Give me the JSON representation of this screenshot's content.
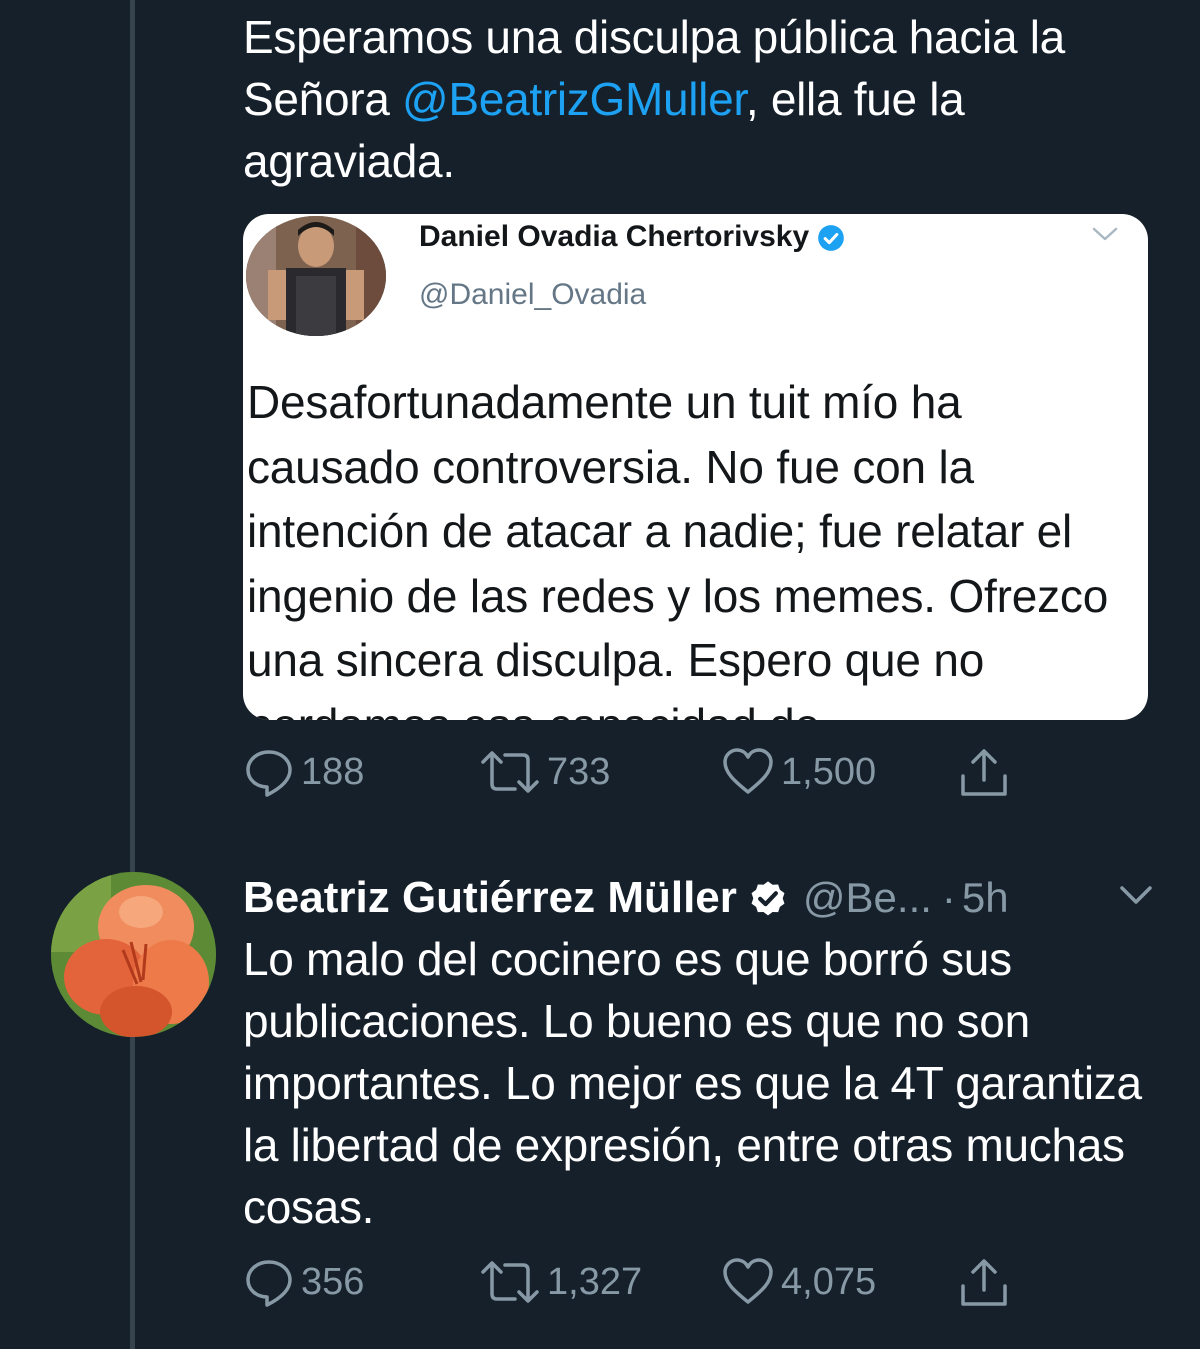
{
  "tweet1": {
    "text_before": "Esperamos una disculpa pública hacia la Señora ",
    "mention": "@BeatrizGMuller",
    "text_after": ", ella fue la agraviada.",
    "embed": {
      "name": "Daniel Ovadia Chertorivsky",
      "handle": "@Daniel_Ovadia",
      "text": "Desafortunadamente un tuit mío ha causado controversia. No fue con la intención de atacar a nadie; fue relatar el ingenio de las redes y los memes. Ofrezco una sincera disculpa. Espero que no perdamos esa capacidad de"
    },
    "stats": {
      "replies": "188",
      "retweets": "733",
      "likes": "1,500"
    }
  },
  "tweet2": {
    "author_name": "Beatriz Gutiérrez Müller",
    "author_handle": "@Be...",
    "dot": "·",
    "time": "5h",
    "text": "Lo malo del cocinero es que borró sus publicaciones. Lo bueno es que no son importantes. Lo mejor es que la 4T garantiza la libertad de expresión, entre otras muchas cosas.",
    "stats": {
      "replies": "356",
      "retweets": "1,327",
      "likes": "4,075"
    }
  },
  "icons": {
    "reply": "reply-icon",
    "retweet": "retweet-icon",
    "like": "heart-icon",
    "share": "share-icon",
    "verified": "verified-badge-icon",
    "more": "chevron-down-icon"
  },
  "colors": {
    "background": "#15202b",
    "accent": "#1da1f2",
    "secondary_text": "#8899a6",
    "thread_line": "#38444d"
  }
}
